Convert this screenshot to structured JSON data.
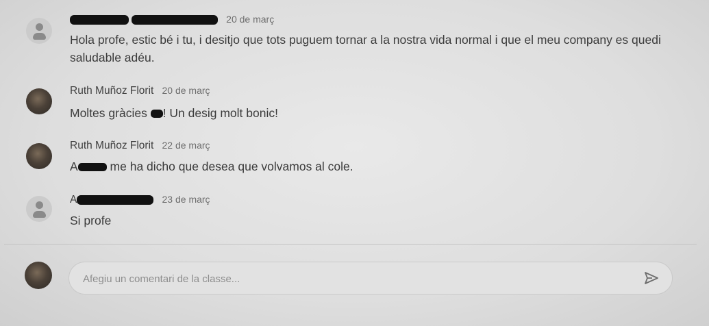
{
  "comments": [
    {
      "author_visible": "",
      "date": "20 de març",
      "text": "Hola profe, estic bé i tu, i desitjo que tots puguem tornar a la nostra vida normal i que el meu company es quedi saludable adéu."
    },
    {
      "author": "Ruth Muñoz Florit",
      "date": "20 de març",
      "text_before": "Moltes gràcies ",
      "text_after": "! Un desig molt bonic!"
    },
    {
      "author": "Ruth Muñoz Florit",
      "date": "22 de març",
      "text_before": "A",
      "text_after": " me ha dicho que desea que volvamos al cole."
    },
    {
      "author_prefix": "A",
      "date": "23 de març",
      "text": "Si profe"
    }
  ],
  "composer": {
    "placeholder": "Afegiu un comentari de la classe..."
  },
  "icons": {
    "send": "send-icon",
    "avatar_placeholder": "person-icon"
  }
}
